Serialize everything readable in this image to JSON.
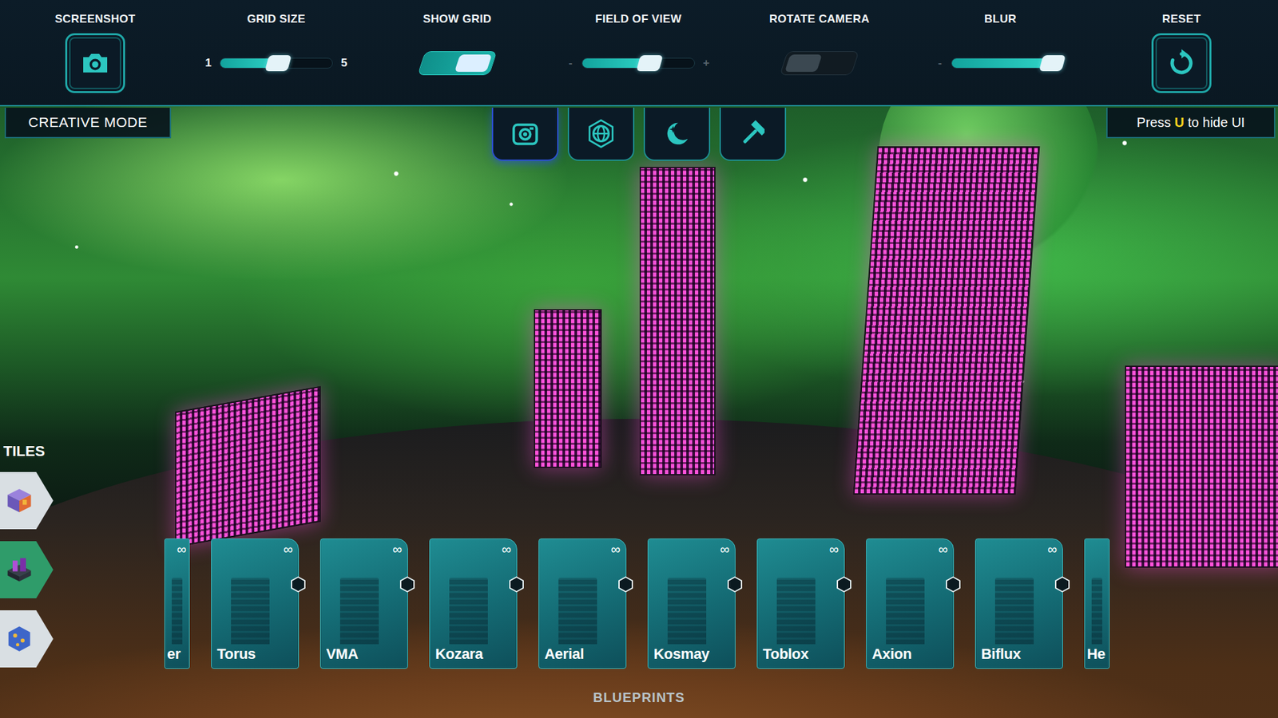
{
  "top_bar": {
    "screenshot": {
      "label": "SCREENSHOT"
    },
    "grid_size": {
      "label": "GRID SIZE",
      "left_label": "1",
      "right_label": "5",
      "labels_dim": false,
      "level": 0.52
    },
    "show_grid": {
      "label": "SHOW GRID",
      "on": true
    },
    "field_of_view": {
      "label": "FIELD OF VIEW",
      "left_label": "-",
      "right_label": "+",
      "labels_dim": true,
      "level": 0.6
    },
    "rotate_camera": {
      "label": "ROTATE CAMERA",
      "on": false
    },
    "blur": {
      "label": "BLUR",
      "left_label": "-",
      "labels_dim": true,
      "level": 0.9
    },
    "reset": {
      "label": "RESET"
    }
  },
  "mode_label": "CREATIVE MODE",
  "tool_buttons": [
    {
      "selected": true
    },
    {
      "selected": false
    },
    {
      "selected": false
    },
    {
      "selected": false
    }
  ],
  "hint": {
    "before": "Press ",
    "key": "U",
    "after": " to hide UI"
  },
  "tiles": {
    "label": "TILES",
    "items": [
      {
        "selected": false
      },
      {
        "selected": true
      },
      {
        "selected": false
      }
    ]
  },
  "blueprints": {
    "label": "BLUEPRINTS",
    "cards": [
      {
        "name": "er",
        "count": "∞",
        "cut": true
      },
      {
        "name": "Torus",
        "count": "∞",
        "cut": false
      },
      {
        "name": "VMA",
        "count": "∞",
        "cut": false
      },
      {
        "name": "Kozara",
        "count": "∞",
        "cut": false
      },
      {
        "name": "Aerial",
        "count": "∞",
        "cut": false
      },
      {
        "name": "Kosmay",
        "count": "∞",
        "cut": false
      },
      {
        "name": "Toblox",
        "count": "∞",
        "cut": false
      },
      {
        "name": "Axion",
        "count": "∞",
        "cut": false
      },
      {
        "name": "Biflux",
        "count": "∞",
        "cut": false
      },
      {
        "name": "He",
        "cut": true
      }
    ]
  }
}
